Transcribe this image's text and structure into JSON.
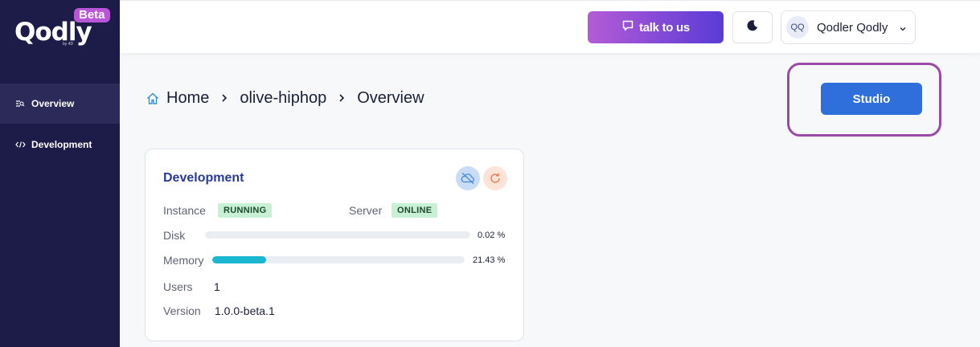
{
  "sidebar": {
    "logo_text": "Qodly",
    "logo_by": "by 4D",
    "beta_label": "Beta",
    "items": [
      {
        "label": "Overview",
        "icon": "overview-icon",
        "active": true
      },
      {
        "label": "Development",
        "icon": "code-icon",
        "active": false
      }
    ]
  },
  "header": {
    "talk_label": "talk to us",
    "theme_icon": "moon-icon",
    "user_initials": "QQ",
    "user_name": "Qodler Qodly"
  },
  "breadcrumb": {
    "items": [
      "Home",
      "olive-hiphop",
      "Overview"
    ]
  },
  "studio_label": "Studio",
  "card": {
    "title": "Development",
    "instance_label": "Instance",
    "instance_status": "RUNNING",
    "server_label": "Server",
    "server_status": "ONLINE",
    "disk_label": "Disk",
    "disk_percent": 0.02,
    "disk_text": "0.02 %",
    "memory_label": "Memory",
    "memory_percent": 21.43,
    "memory_text": "21.43 %",
    "users_label": "Users",
    "users_value": "1",
    "version_label": "Version",
    "version_value": "1.0.0-beta.1"
  },
  "colors": {
    "sidebar_bg": "#1d1b48",
    "accent": "#2f6fdc",
    "badge_green": "#c7f0d4",
    "memory_fill": "#1ab5cf",
    "highlight": "#9a4aa8"
  }
}
